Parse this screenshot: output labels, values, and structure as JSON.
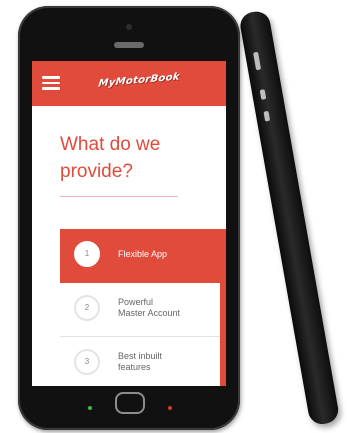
{
  "app": {
    "logo_text": "MyMotorBook"
  },
  "header": {
    "menu_icon": "hamburger-menu-icon",
    "accent_color": "#e04b3c"
  },
  "main": {
    "heading": "What do we provide?"
  },
  "features": [
    {
      "number": "1",
      "label": "Flexible App",
      "active": true
    },
    {
      "number": "2",
      "label": "Powerful\nMaster Account",
      "active": false
    },
    {
      "number": "3",
      "label": "Best inbuilt\nfeatures",
      "active": false
    }
  ]
}
